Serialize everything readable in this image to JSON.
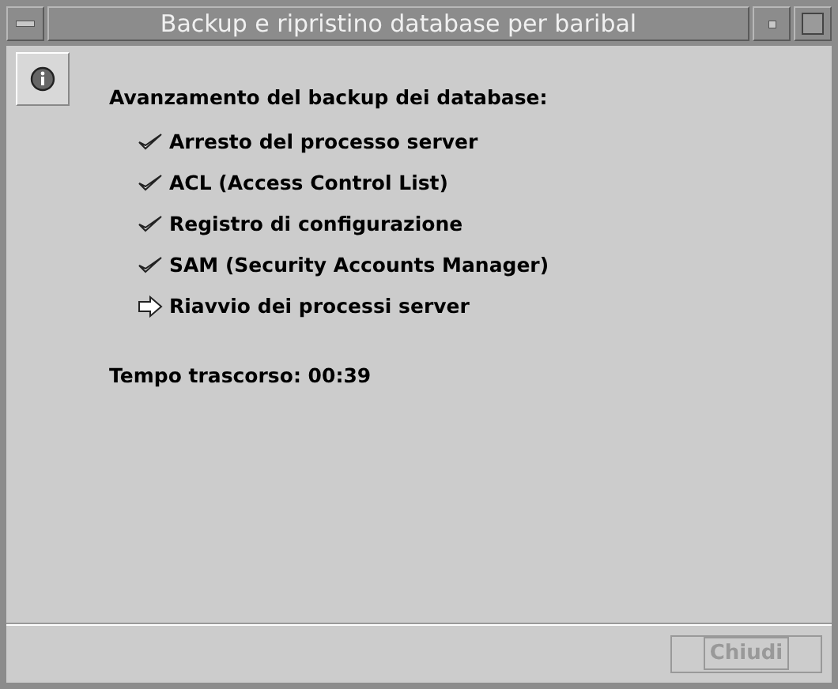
{
  "window": {
    "title": "Backup e ripristino database per baribal"
  },
  "heading": "Avanzamento del backup dei database:",
  "steps": [
    {
      "label": "Arresto del processo server",
      "kind": "done"
    },
    {
      "label": "ACL (Access Control List)",
      "kind": "done"
    },
    {
      "label": "Registro di configurazione",
      "kind": "done"
    },
    {
      "label": "SAM (Security Accounts Manager)",
      "kind": "done"
    },
    {
      "label": "Riavvio dei processi server",
      "kind": "current"
    }
  ],
  "elapsed": "Tempo trascorso: 00:39",
  "buttons": [
    {
      "label": "Chiudi",
      "disabled": true
    }
  ]
}
